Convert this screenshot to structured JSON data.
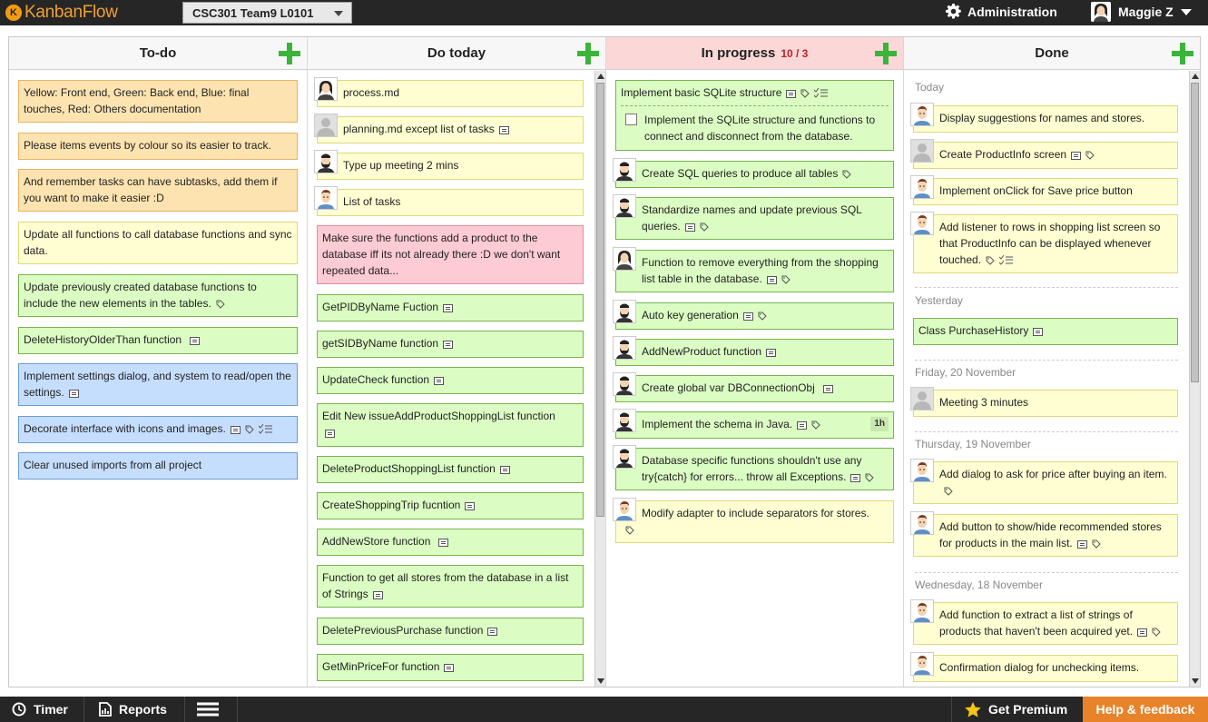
{
  "app": {
    "logo_text": "KanbanFlow"
  },
  "header": {
    "board_name": "CSC301 Team9 L0101",
    "admin_label": "Administration",
    "user_name": "Maggie Z"
  },
  "columns": [
    {
      "title": "To-do",
      "wip": ""
    },
    {
      "title": "Do today",
      "wip": ""
    },
    {
      "title": "In progress",
      "wip": "10 / 3"
    },
    {
      "title": "Done",
      "wip": ""
    }
  ],
  "todo": [
    "Yellow: Front end, Green: Back end, Blue: final touches, Red: Others documentation",
    "Please items events by colour so its easier to track.",
    "And remember tasks can have subtasks, add them if you want to make it easier :D",
    "Update all functions to call database functions and sync data.",
    "Update previously created database functions to include the new elements in the tables.",
    "DeleteHistoryOlderThan function",
    "Implement settings dialog, and system to read/open the settings.",
    "Decorate interface with icons and images.",
    "Clear unused imports from all project"
  ],
  "today": [
    "process.md",
    "planning.md except list of tasks",
    "Type up meeting 2 mins",
    "List of tasks",
    "Make sure the functions add a product to the database iff its not already there :D we don't want repeated data...",
    "GetPIDByName Fuction",
    "getSIDByName function",
    "UpdateCheck function",
    "Edit New issueAddProductShoppingList function",
    "DeleteProductShoppingList function",
    "CreateShoppingTrip fucntion",
    "AddNewStore function",
    "Function to get all stores from the database in a list of Strings",
    "DeletePreviousPurchase function",
    "GetMinPriceFor function"
  ],
  "progress": [
    "Implement basic SQLite structure",
    "Implement the SQLite structure and functions to connect and disconnect from the database.",
    "Create SQL queries to produce all tables",
    "Standardize names and update previous SQL queries.",
    "Function to remove everything from the shopping list table in the database.",
    "Auto key generation",
    "AddNewProduct function",
    "Create global var DBConnectionObj",
    "Implement the schema in Java.",
    "Database specific functions shouldn't use any try{catch} for errors... throw all Exceptions.",
    "Modify adapter to include separators for stores."
  ],
  "progress_badge": "1h",
  "done": {
    "days": [
      "Today",
      "Yesterday",
      "Friday, 20 November",
      "Thursday, 19 November",
      "Wednesday, 18 November"
    ],
    "tasks": [
      "Display suggestions for names and stores.",
      "Create ProductInfo screen",
      "Implement onClick for Save price button",
      "Add listener to rows in shopping list screen so that ProductInfo can be displayed whenever touched.",
      "Class PurchaseHistory",
      "Meeting 3 minutes",
      "Add dialog to ask for price after buying an item.",
      "Add button to show/hide recommended stores for products in the main list.",
      "Add function to extract a list of strings of products that haven't been acquired yet.",
      "Confirmation dialog for unchecking items."
    ]
  },
  "footer": {
    "timer": "Timer",
    "reports": "Reports",
    "premium": "Get Premium",
    "help": "Help & feedback"
  },
  "colors": {
    "yellow": "#fefed2",
    "orange": "#fde3b0",
    "green": "#dbfdc3",
    "blue": "#c6defe",
    "pink": "#fdcbd4",
    "help": "#e8832a"
  }
}
